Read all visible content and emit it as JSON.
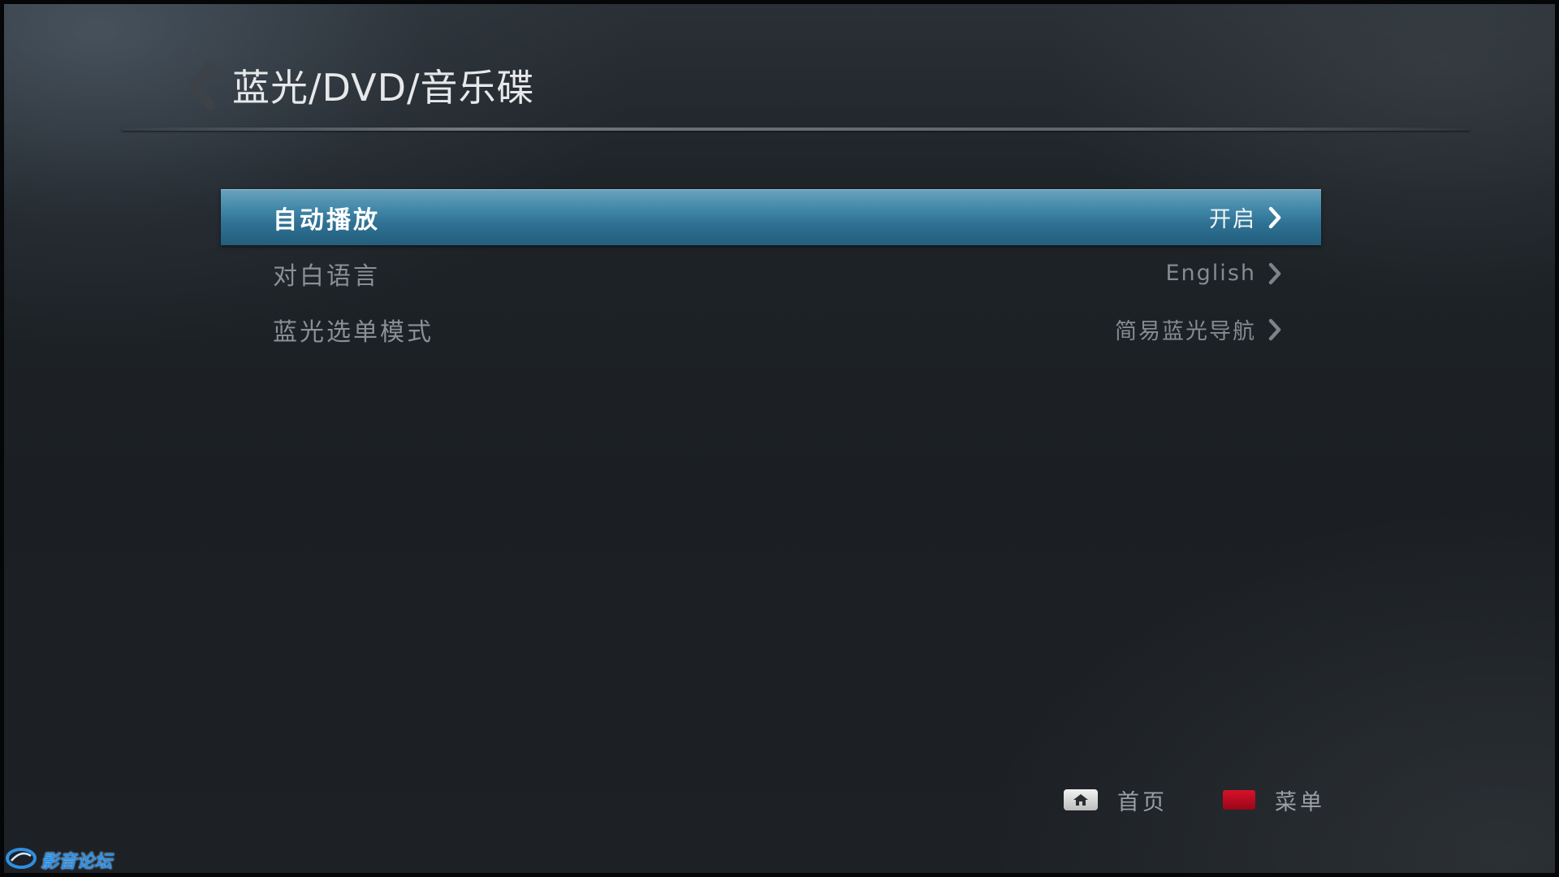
{
  "header": {
    "title": "蓝光/DVD/音乐碟",
    "back_icon": "chevron-left-icon"
  },
  "menu": {
    "selected_index": 0,
    "items": [
      {
        "label": "自动播放",
        "value": "开启"
      },
      {
        "label": "对白语言",
        "value": "English"
      },
      {
        "label": "蓝光选单模式",
        "value": "简易蓝光导航"
      }
    ]
  },
  "footer": {
    "home_label": "首页",
    "menu_label": "菜单",
    "home_icon": "home-key-icon",
    "menu_icon": "red-key-icon"
  },
  "watermark": {
    "text": "影音论坛"
  },
  "colors": {
    "selected_bar": "#2f7193",
    "text_dim": "#8a9096",
    "red_key": "#d6122a"
  }
}
